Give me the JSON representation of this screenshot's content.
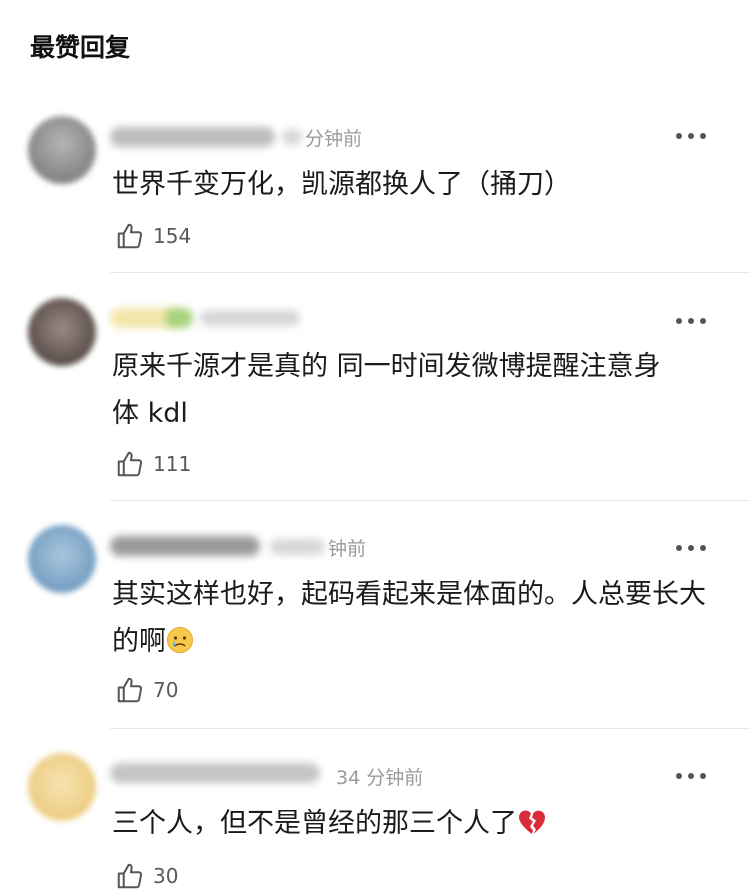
{
  "section": {
    "title": "最赞回复"
  },
  "comments": [
    {
      "time": "分钟前",
      "text": "世界千变万化，凯源都换人了（捅刀）",
      "likes": "154"
    },
    {
      "time": "",
      "text": "原来千源才是真的 同一时间发微博提醒注意身体 kdl",
      "likes": "111"
    },
    {
      "time": "钟前",
      "text": "其实这样也好，起码看起来是体面的。人总要长大的啊",
      "emoji": "crying-face",
      "likes": "70"
    },
    {
      "time": "34 分钟前",
      "text": "三个人，但不是曾经的那三个人了",
      "emoji": "broken-heart",
      "likes": "30"
    }
  ],
  "colors": {
    "avatar1": "#8a8a8a",
    "avatar2": "#6b5b55",
    "avatar3": "#6fa0c9",
    "avatar4": "#f0d28a",
    "divider": "#e6e6e6"
  }
}
